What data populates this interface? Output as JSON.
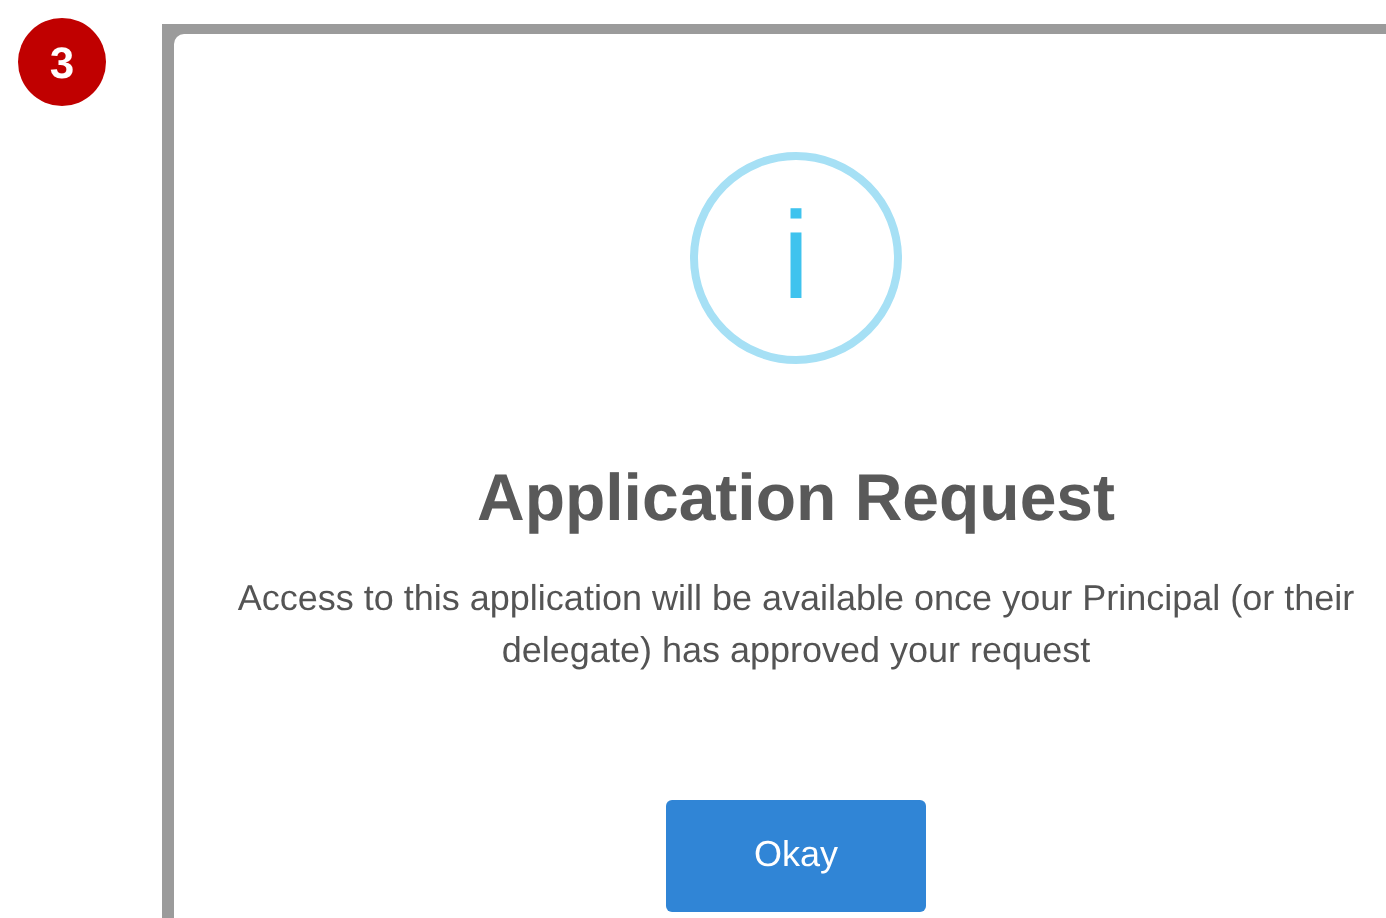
{
  "step_badge": "3",
  "dialog": {
    "icon": "i",
    "title": "Application Request",
    "message": "Access to this application will be available once your Principal (or their delegate) has approved your request",
    "button": "Okay"
  }
}
